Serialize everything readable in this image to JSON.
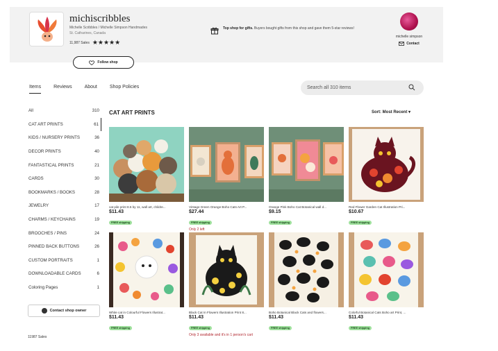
{
  "shop": {
    "name": "michiscribbles",
    "subtitle": "Michelle Scribbles / Michelle Simpson Handmades",
    "location": "St. Catharines, Canada",
    "sales": "11,987 Sales",
    "rating_stars": "★★★★★",
    "follow_label": "Follow shop"
  },
  "promo": {
    "bold": "Top shop for gifts.",
    "text": " Buyers bought gifts from this shop and gave them 5-star reviews!"
  },
  "owner": {
    "name": "michelle simpson",
    "contact_label": "Contact"
  },
  "tabs": [
    {
      "label": "Items"
    },
    {
      "label": "Reviews"
    },
    {
      "label": "About"
    },
    {
      "label": "Shop Policies"
    }
  ],
  "search": {
    "placeholder": "Search all 310 items"
  },
  "sidebar": {
    "categories": [
      {
        "label": "All",
        "count": "310"
      },
      {
        "label": "CAT ART PRINTS",
        "count": "61"
      },
      {
        "label": "KIDS / NURSERY PRINTS",
        "count": "36"
      },
      {
        "label": "DECOR PRINTS",
        "count": "40"
      },
      {
        "label": "FANTASTICAL PRINTS",
        "count": "21"
      },
      {
        "label": "CARDS",
        "count": "30"
      },
      {
        "label": "BOOKMARKS / BOOKS",
        "count": "28"
      },
      {
        "label": "JEWELRY",
        "count": "17"
      },
      {
        "label": "CHARMS / KEYCHAINS",
        "count": "19"
      },
      {
        "label": "BROOCHES / PINS",
        "count": "24"
      },
      {
        "label": "PINNED BACK BUTTONS",
        "count": "26"
      },
      {
        "label": "CUSTOM PORTRAITS",
        "count": "1"
      },
      {
        "label": "DOWNLOADABLE CARDS",
        "count": "6"
      },
      {
        "label": "Coloring Pages",
        "count": "1"
      }
    ],
    "contact_owner_label": "Contact shop owner",
    "sales_text": "11987 Sales"
  },
  "main": {
    "section_title": "CAT ART PRINTS",
    "sort_label": "Sort: Most Recent"
  },
  "products": [
    {
      "title": "cat pile print 8.5 by 11, wall art, childre...",
      "price": "$11.43",
      "shipping": "FREE shipping",
      "stock": ""
    },
    {
      "title": "Vintage Green Orange Boho Cats Art P...",
      "price": "$27.44",
      "shipping": "FREE shipping",
      "stock": "Only 2 left"
    },
    {
      "title": "Orange Pink Boho Cat Botanical wall d...",
      "price": "$9.15",
      "shipping": "FREE shipping",
      "stock": ""
    },
    {
      "title": "Red Flower Garden Cat Illustration Pri...",
      "price": "$10.67",
      "shipping": "FREE shipping",
      "stock": ""
    },
    {
      "title": "White cat in Colourful Flowers Illustrat...",
      "price": "$11.43",
      "shipping": "FREE shipping",
      "stock": ""
    },
    {
      "title": "Black Cat In Flowers Illustration Print 8...",
      "price": "$11.43",
      "shipping": "FREE shipping",
      "stock": "Only 3 available and it's in 1 person's cart"
    },
    {
      "title": "Boho Botanical Black Cats and flowers...",
      "price": "$11.43",
      "shipping": "FREE shipping",
      "stock": ""
    },
    {
      "title": "Colorful Botanical Cats Boho art Print, ...",
      "price": "$11.43",
      "shipping": "FREE shipping",
      "stock": ""
    }
  ],
  "colors": {
    "header_bg": "#f2f2f2",
    "free_shipping": "#9ee09c",
    "stock_warning": "#b0252d"
  }
}
